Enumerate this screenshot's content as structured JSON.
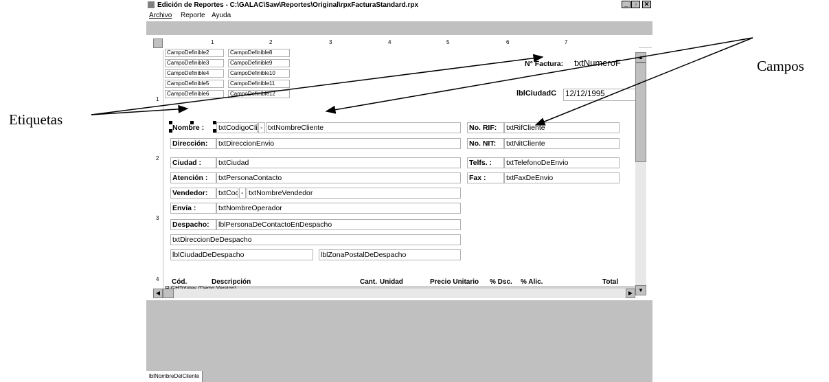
{
  "window": {
    "title": "Edición de Reportes - C:\\GALAC\\Saw\\Reportes\\Original\\rpxFacturaStandard.rpx",
    "minimize": "_",
    "maximize": "▫",
    "close": "✕"
  },
  "menu": {
    "archivo": "Archivo",
    "reporte": "Reporte",
    "ayuda": "Ayuda"
  },
  "ruler": {
    "h_numbers": [
      "1",
      "2",
      "3",
      "4",
      "5",
      "6",
      "7"
    ],
    "v_numbers": [
      "1",
      "2",
      "3",
      "4"
    ]
  },
  "callouts": {
    "left": "Etiquetas",
    "right": "Campos"
  },
  "fields": {
    "cd2": "CampoDefinible2",
    "cd8": "CampoDefinible8",
    "cd3": "CampoDefinible3",
    "cd9": "CampoDefinible9",
    "cd4": "CampoDefinible4",
    "cd10": "CampoDefinible10",
    "cd5": "CampoDefinible5",
    "cd11": "CampoDefinible11",
    "cd6": "CampoDefinible6",
    "cd12": "CampoDefinible12",
    "nfactura_label": "N° Factura:",
    "nfactura_value": "txtNumeroF",
    "ciudad_c_label": "lblCiudadC",
    "fecha_value": "12/12/1995",
    "nombre_label": "Nombre  :",
    "codigo_cli": "txtCodigoCli",
    "dash": "-",
    "nombre_cliente": "txtNombreCliente",
    "rif_label": "No. RIF:",
    "rif_value": "txtRifCliente",
    "direccion_label": "Dirección:",
    "direccion_value": "txtDireccionEnvio",
    "nit_label": "No. NIT:",
    "nit_value": "txtNitCliente",
    "ciudad_label": "Ciudad   :",
    "ciudad_value": "txtCiudad",
    "telfs_label": "Telfs.  :",
    "telfs_value": "txtTelefonoDeEnvio",
    "atencion_label": "Atención :",
    "atencion_value": "txtPersonaContacto",
    "fax_label": "Fax    :",
    "fax_value": "txtFaxDeEnvio",
    "vendedor_label": "Vendedor:",
    "vendedor_cod": "txtCod",
    "vendedor_nombre": "txtNombreVendedor",
    "envia_label": "Envía    :",
    "envia_value": "txtNombreOperador",
    "despacho_label": "Despacho:",
    "despacho_value": "lblPersonaDeContactoEnDespacho",
    "direccion_despacho": "txtDireccionDeDespacho",
    "ciudad_despacho": "lblCiudadDeDespacho",
    "zona_postal": "lblZonaPostalDeDespacho"
  },
  "columns": {
    "cod": "Cód.",
    "descripcion": "Descripción",
    "cant": "Cant.",
    "unidad": "Unidad",
    "precio": "Precio Unitario",
    "pdsc": "% Dsc.",
    "palic": "% Alic.",
    "total": "Total"
  },
  "section_label": "⊟ GHTotales (Demo Version)",
  "status": {
    "field": "lblNombreDelCliente"
  }
}
